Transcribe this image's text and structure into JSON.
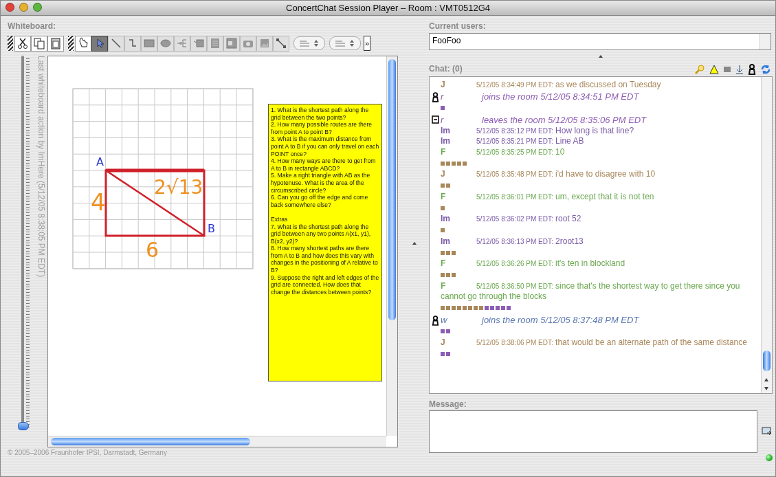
{
  "window": {
    "title": "ConcertChat Session Player – Room : VMT0512G4"
  },
  "whiteboard": {
    "label": "Whiteboard:",
    "tool_groups": [
      [
        {
          "kind": "cut",
          "selected": false
        },
        {
          "kind": "copy",
          "selected": false
        },
        {
          "kind": "paste",
          "selected": false
        }
      ],
      [
        {
          "kind": "hand",
          "selected": false
        },
        {
          "kind": "pointer",
          "selected": true
        },
        {
          "kind": "line",
          "selected": false
        },
        {
          "kind": "connector",
          "selected": false
        },
        {
          "kind": "rectangle",
          "selected": false
        },
        {
          "kind": "ellipse",
          "selected": false
        },
        {
          "kind": "tree",
          "selected": false
        },
        {
          "kind": "callout",
          "selected": false
        },
        {
          "kind": "text",
          "selected": false
        },
        {
          "kind": "window",
          "selected": false
        },
        {
          "kind": "camera",
          "selected": false
        },
        {
          "kind": "image",
          "selected": false
        },
        {
          "kind": "link",
          "selected": false
        }
      ]
    ],
    "more": "»",
    "history": {
      "label": "Last whiteboard action by ImHere (5/12/05 8:38:05 PM EDT)",
      "level": 0
    },
    "annotations": [
      {
        "text": "A",
        "color": "#2a3ad0"
      },
      {
        "text": "B",
        "color": "#2a3ad0"
      },
      {
        "text": "4",
        "color": "#f09020"
      },
      {
        "text": "6",
        "color": "#f09020"
      },
      {
        "text": "2√13",
        "color": "#f09020"
      }
    ],
    "note": {
      "questions": [
        "1. What is the shortest path along the grid between the two points?",
        "2. How many possible routes are there from point A to point B?",
        "3. What is the maximum distance from point A to B if you can only travel on each POINT once?",
        "4. How many ways are there to get from A to B in rectangle ABCD?",
        "5. Make a right triangle with AB as the hypotenuse. What is the area of the circumscribed circle?",
        "6. Can you go off the edge and come back somewhere else?"
      ],
      "extras_title": "Extras",
      "extras": [
        "7. What is the shortest path along the grid between any two points A(x1, y1), B(x2, y2)?",
        "8. How many shortest paths are there from A to B and how does this vary with changes in the positioning of A relative to B?",
        "9. Suppose the right and left edges of the grid are connected. How does that change the distances between points?"
      ]
    }
  },
  "footer": "© 2005–2006 Fraunhofer IPSI, Darmstadt, Germany",
  "users": {
    "label": "Current users:",
    "items": [
      "FooFoo"
    ]
  },
  "chat": {
    "label": "Chat: (0)",
    "messages": [
      {
        "kind": "message",
        "name": "J",
        "time": "5/12/05 8:34:49 PM EDT:",
        "text": "as we discussed on Tuesday",
        "color": "#a8875a"
      },
      {
        "kind": "join",
        "name": "r",
        "text": "joins the room 5/12/05 8:34:51 PM EDT",
        "color": "#8e5cb5",
        "marks": [
          {
            "color": "#8e5cb5"
          }
        ]
      },
      {
        "kind": "leave",
        "name": "r",
        "text": "leaves the room 5/12/05 8:35:06 PM EDT",
        "color": "#8e5cb5"
      },
      {
        "kind": "message",
        "name": "Im",
        "time": "5/12/05 8:35:12 PM EDT:",
        "text": "How long is that line?",
        "color": "#7a5aa8"
      },
      {
        "kind": "message",
        "name": "Im",
        "time": "5/12/05 8:35:21 PM EDT:",
        "text": "Line AB",
        "color": "#7a5aa8"
      },
      {
        "kind": "message",
        "name": "F",
        "time": "5/12/05 8:35:25 PM EDT:",
        "text": "10",
        "color": "#6aa84f",
        "marks": [
          {
            "color": "#a8875a"
          },
          {
            "color": "#a8875a"
          },
          {
            "color": "#a8875a"
          },
          {
            "color": "#a8875a"
          },
          {
            "color": "#a8875a"
          }
        ]
      },
      {
        "kind": "message",
        "name": "J",
        "time": "5/12/05 8:35:48 PM EDT:",
        "text": "i'd have to disagree with 10",
        "color": "#a8875a",
        "marks": [
          {
            "color": "#a8875a"
          },
          {
            "color": "#a8875a"
          }
        ]
      },
      {
        "kind": "message",
        "name": "F",
        "time": "5/12/05 8:36:01 PM EDT:",
        "text": "um, except that it is not ten",
        "color": "#6aa84f",
        "marks": [
          {
            "color": "#a8875a"
          }
        ]
      },
      {
        "kind": "message",
        "name": "Im",
        "time": "5/12/05 8:36:02 PM EDT:",
        "text": "root 52",
        "color": "#7a5aa8",
        "marks": [
          {
            "color": "#a8875a"
          }
        ]
      },
      {
        "kind": "message",
        "name": "Im",
        "time": "5/12/05 8:36:13 PM EDT:",
        "text": "2root13",
        "color": "#7a5aa8",
        "marks": [
          {
            "color": "#a8875a"
          },
          {
            "color": "#a8875a"
          },
          {
            "color": "#a8875a"
          }
        ]
      },
      {
        "kind": "message",
        "name": "F",
        "time": "5/12/05 8:36:26 PM EDT:",
        "text": "it's ten in blockland",
        "color": "#6aa84f",
        "marks": [
          {
            "color": "#a8875a"
          },
          {
            "color": "#a8875a"
          },
          {
            "color": "#a8875a"
          }
        ]
      },
      {
        "kind": "message",
        "name": "F",
        "time": "5/12/05 8:36:50 PM EDT:",
        "text": "since that's the shortest way to get there since you cannot go through the blocks",
        "color": "#6aa84f",
        "marks": [
          {
            "color": "#a8875a"
          },
          {
            "color": "#a8875a"
          },
          {
            "color": "#a8875a"
          },
          {
            "color": "#a8875a"
          },
          {
            "color": "#a8875a"
          },
          {
            "color": "#a8875a"
          },
          {
            "color": "#a8875a"
          },
          {
            "color": "#a8875a"
          },
          {
            "color": "#8e5cb5"
          },
          {
            "color": "#8e5cb5"
          },
          {
            "color": "#8e5cb5"
          },
          {
            "color": "#8e5cb5"
          },
          {
            "color": "#8e5cb5"
          }
        ]
      },
      {
        "kind": "join",
        "name": "w",
        "text": "joins the room 5/12/05 8:37:48 PM EDT",
        "color": "#5a78b0",
        "marks": [
          {
            "color": "#8e5cb5"
          },
          {
            "color": "#8e5cb5"
          }
        ]
      },
      {
        "kind": "message",
        "name": "J",
        "time": "5/12/05 8:38:06 PM EDT:",
        "text": "that would be an alternate path of the same distance",
        "color": "#a8875a",
        "marks": [
          {
            "color": "#8e5cb5"
          },
          {
            "color": "#8e5cb5"
          }
        ]
      }
    ]
  },
  "message": {
    "label": "Message:"
  }
}
